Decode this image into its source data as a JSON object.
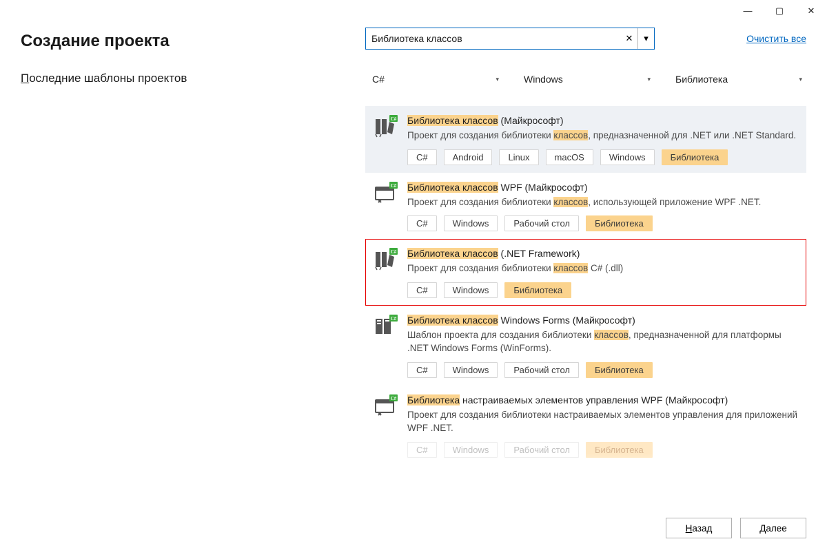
{
  "window": {
    "minimize": "—",
    "maximize": "▢",
    "close": "✕"
  },
  "page_title": "Создание проекта",
  "recent_heading_first": "П",
  "recent_heading_rest": "оследние шаблоны проектов",
  "search": {
    "value": "Библиотека классов",
    "clear_glyph": "✕",
    "dd_glyph": "▾"
  },
  "clear_all": "Очистить все",
  "filters": {
    "language": "C#",
    "platform": "Windows",
    "type": "Библиотека",
    "chev": "▾"
  },
  "templates": [
    {
      "name_hl": "Библиотека классов",
      "name_rest": " (Майкрософт)",
      "desc_pre": "Проект для создания библиотеки ",
      "desc_hl": "классов",
      "desc_post": ", предназначенной для .NET или .NET Standard.",
      "tags": [
        "C#",
        "Android",
        "Linux",
        "macOS",
        "Windows",
        "Библиотека"
      ],
      "hl_tags": [
        5
      ],
      "selected": true,
      "highlighted": false,
      "icon": "lib"
    },
    {
      "name_hl": "Библиотека классов",
      "name_rest": " WPF (Майкрософт)",
      "desc_pre": "Проект для создания библиотеки ",
      "desc_hl": "классов",
      "desc_post": ", использующей приложение WPF .NET.",
      "tags": [
        "C#",
        "Windows",
        "Рабочий стол",
        "Библиотека"
      ],
      "hl_tags": [
        3
      ],
      "selected": false,
      "highlighted": false,
      "icon": "wpf"
    },
    {
      "name_hl": "Библиотека классов",
      "name_rest": " (.NET Framework)",
      "desc_pre": "Проект для создания библиотеки ",
      "desc_hl": "классов",
      "desc_post": " C# (.dll)",
      "tags": [
        "C#",
        "Windows",
        "Библиотека"
      ],
      "hl_tags": [
        2
      ],
      "selected": false,
      "highlighted": true,
      "icon": "lib"
    },
    {
      "name_hl": "Библиотека классов",
      "name_rest": " Windows Forms (Майкрософт)",
      "desc_pre": "Шаблон проекта для создания библиотеки ",
      "desc_hl": "классов",
      "desc_post": ", предназначенной для платформы .NET Windows Forms (WinForms).",
      "tags": [
        "C#",
        "Windows",
        "Рабочий стол",
        "Библиотека"
      ],
      "hl_tags": [
        3
      ],
      "selected": false,
      "highlighted": false,
      "icon": "winforms"
    },
    {
      "name_hl": "Библиотека",
      "name_rest": " настраиваемых элементов управления WPF (Майкрософт)",
      "desc_pre": "Проект для создания библиотеки настраиваемых элементов управления для приложений WPF .NET.",
      "desc_hl": "",
      "desc_post": "",
      "tags": [
        "C#",
        "Windows",
        "Рабочий стол",
        "Библиотека"
      ],
      "hl_tags": [
        3
      ],
      "selected": false,
      "highlighted": false,
      "faded": true,
      "icon": "wpf"
    }
  ],
  "footer": {
    "back_u": "Н",
    "back_rest": "азад",
    "next_u": "Д",
    "next_rest": "алее"
  }
}
